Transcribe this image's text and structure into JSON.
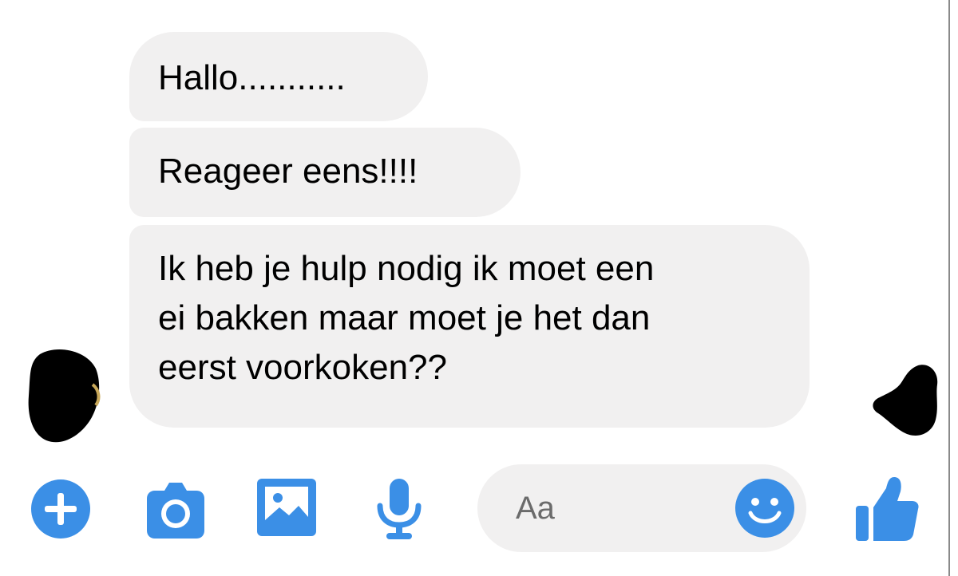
{
  "conversation": {
    "messages": [
      {
        "text": "Hallo..........."
      },
      {
        "text": "Reageer eens!!!!"
      },
      {
        "text_lines": [
          "Ik heb je hulp nodig ik moet een",
          "ei bakken maar moet je het dan",
          "eerst voorkoken??"
        ]
      }
    ]
  },
  "composer": {
    "placeholder": "Aa"
  },
  "toolbar": {
    "icons": [
      "plus-icon",
      "camera-icon",
      "image-icon",
      "microphone-icon",
      "emoji-icon",
      "thumbs-up-icon"
    ]
  },
  "colors": {
    "accent": "#3b8fe6",
    "bubble_bg": "#f1f0f0",
    "redaction": "#000000"
  }
}
